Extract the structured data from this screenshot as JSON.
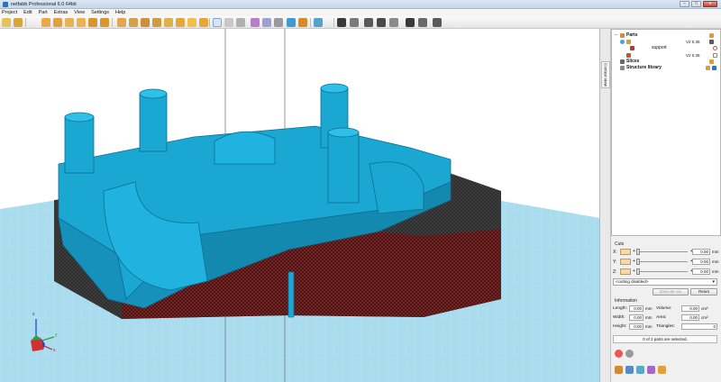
{
  "window": {
    "title": "netfabb Professional 6.0 64bit",
    "min": "–",
    "max": "□",
    "close": "x"
  },
  "menu": [
    "Project",
    "Edit",
    "Part",
    "Extras",
    "View",
    "Settings",
    "Help"
  ],
  "tree": {
    "parts_label": "Parts",
    "part1_version": "V2 0.35",
    "support_label": "support",
    "part2_version": "V2 0.35",
    "slices_label": "Slices",
    "structure_label": "Structure library"
  },
  "side_tab_label": "Context view",
  "cuts": {
    "header": "Cuts",
    "rows": [
      {
        "axis": "X:",
        "value": "0.00",
        "unit": "mm"
      },
      {
        "axis": "Y:",
        "value": "0.00",
        "unit": "mm"
      },
      {
        "axis": "Z:",
        "value": "0.00",
        "unit": "mm"
      }
    ],
    "mode": "<cutting disabled>",
    "execute_label": "Execute cut",
    "reset_label": "Reset"
  },
  "info": {
    "header": "Information",
    "length_label": "Length:",
    "length_value": "0.00",
    "length_unit": "mm",
    "width_label": "Width:",
    "width_value": "0.00",
    "width_unit": "mm",
    "height_label": "Height:",
    "height_value": "0.00",
    "height_unit": "mm",
    "volume_label": "Volume:",
    "volume_value": "0.00",
    "volume_unit": "cm³",
    "area_label": "Area:",
    "area_value": "0.00",
    "area_unit": "cm²",
    "triangles_label": "Triangles:",
    "triangles_value": "0"
  },
  "status": "0 of 2 parts are selected.",
  "axes": {
    "z": "z",
    "y": "y",
    "x": "x"
  },
  "colors": {
    "part": "#1aa7d2",
    "support": "#2b2b2b",
    "support_red": "#b01818",
    "platform": "#a9dcef"
  }
}
